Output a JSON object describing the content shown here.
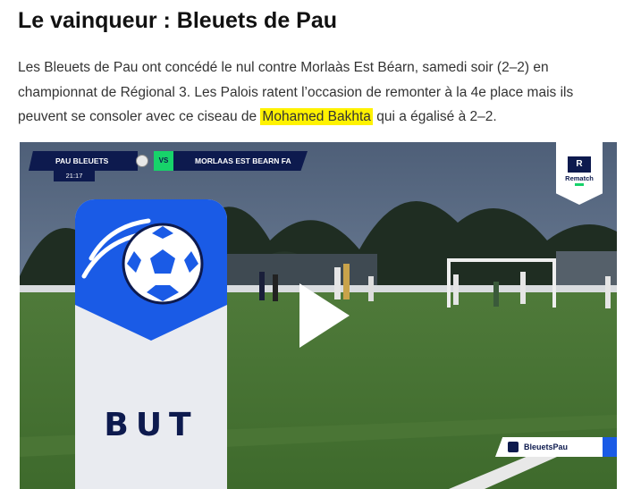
{
  "article": {
    "title": "Le vainqueur : Bleuets de Pau",
    "paragraph_before": "Les Bleuets de Pau ont concédé le nul contre Morlaàs Est Béarn, samedi soir (2–2) en championnat de Régional 3. Les Palois ratent l’occasion de remonter à la 4e place mais ils peuvent se consoler avec ce ciseau de ",
    "highlight": "Mohamed Bakhta",
    "paragraph_after": " qui a égalisé à 2–2."
  },
  "video": {
    "scoreboard": {
      "home_team": "PAU BLEUETS",
      "vs": "VS",
      "away_team": "MORLAAS EST BEARN FA",
      "clock": "21:17"
    },
    "rematch_label": "Rematch",
    "rematch_logo": "R",
    "goal_card_text": "BUT",
    "club_tag": "BleuetsPau",
    "colors": {
      "navy": "#0d1a4e",
      "brand_blue": "#1a5be6",
      "vs_green": "#17d36a",
      "highlight_yellow": "#fff200"
    },
    "icons": [
      "play-icon",
      "soccer-ball-icon",
      "club-icon"
    ]
  }
}
